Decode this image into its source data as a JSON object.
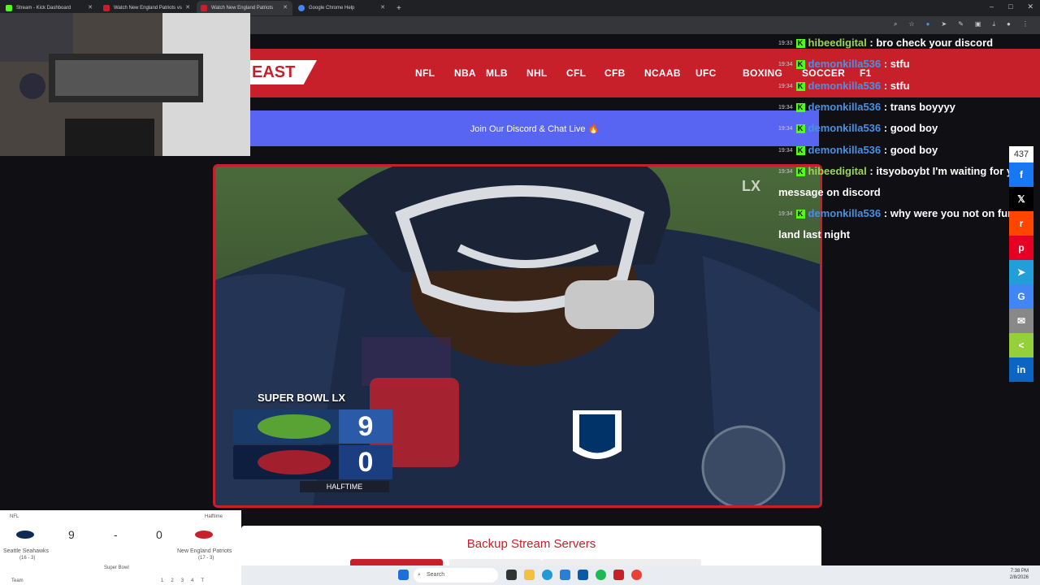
{
  "browser": {
    "tabs": [
      {
        "title": "Stream - Kick Dashboard",
        "color": "#53fc18",
        "active": false
      },
      {
        "title": "Watch New England Patriots vs",
        "color": "#c8202b",
        "active": false
      },
      {
        "title": "Watch New England Patriots",
        "color": "#c8202b",
        "active": true
      },
      {
        "title": "Google Chrome Help",
        "color": "#4285f4",
        "active": false
      }
    ],
    "new_tab": "+",
    "window_controls": [
      "–",
      "□",
      "✕"
    ]
  },
  "site": {
    "logo": "EAST",
    "nav": [
      "NFL",
      "NBA",
      "MLB",
      "NHL",
      "CFL",
      "CFB",
      "NCAAB",
      "UFC",
      "BOXING",
      "SOCCER",
      "F1"
    ],
    "discord_banner": "Join Our Discord & Chat Live 🔥",
    "backup_title": "Backup Stream Servers"
  },
  "video": {
    "scorebug": {
      "title": "SUPER BOWL LX",
      "home_score": "9",
      "away_score": "0",
      "status": "HALFTIME"
    },
    "watermark": "LX"
  },
  "chat": [
    {
      "time": "19:33",
      "user": "hibeedigital",
      "user_color": "green",
      "text": "bro check your discord"
    },
    {
      "time": "19:34",
      "user": "demonkilla536",
      "user_color": "blue",
      "text": "stfu"
    },
    {
      "time": "19:34",
      "user": "demonkilla536",
      "user_color": "blue",
      "text": "stfu"
    },
    {
      "time": "19:34",
      "user": "demonkilla536",
      "user_color": "blue",
      "text": "trans boyyyy"
    },
    {
      "time": "19:34",
      "user": "demonkilla536",
      "user_color": "blue",
      "text": "good boy"
    },
    {
      "time": "19:34",
      "user": "demonkilla536",
      "user_color": "blue",
      "text": "good boy"
    },
    {
      "time": "19:34",
      "user": "hibeedigital",
      "user_color": "green",
      "text": "itsyoboybt I'm waiting for your message on discord"
    },
    {
      "time": "19:34",
      "user": "demonkilla536",
      "user_color": "blue",
      "text": "why were you not on furry land last night"
    }
  ],
  "share": {
    "count": "437",
    "buttons": [
      {
        "icon": "facebook-icon",
        "glyph": "f",
        "color": "#1877f2"
      },
      {
        "icon": "x-icon",
        "glyph": "𝕏",
        "color": "#000000"
      },
      {
        "icon": "reddit-icon",
        "glyph": "r",
        "color": "#ff4500"
      },
      {
        "icon": "pinterest-icon",
        "glyph": "p",
        "color": "#e60023"
      },
      {
        "icon": "telegram-icon",
        "glyph": "➤",
        "color": "#229ed9"
      },
      {
        "icon": "google-icon",
        "glyph": "G",
        "color": "#4285f4"
      },
      {
        "icon": "email-icon",
        "glyph": "✉",
        "color": "#888888"
      },
      {
        "icon": "share-icon",
        "glyph": "<",
        "color": "#95d03a"
      },
      {
        "icon": "linkedin-icon",
        "glyph": "in",
        "color": "#0a66c2"
      }
    ]
  },
  "widget": {
    "league": "NFL",
    "status": "Halftime",
    "home_team": "Seattle Seahawks",
    "home_record": "(16 - 3)",
    "away_team": "New England Patriots",
    "away_record": "(17 - 3)",
    "home_score": "9",
    "separator": "-",
    "away_score": "0",
    "event": "Super Bowl",
    "team_abbr": "Team",
    "quarters": [
      "1",
      "2",
      "3",
      "4",
      "T"
    ]
  },
  "taskbar": {
    "search_placeholder": "Search",
    "time": "7:38 PM",
    "date": "2/8/2026"
  }
}
